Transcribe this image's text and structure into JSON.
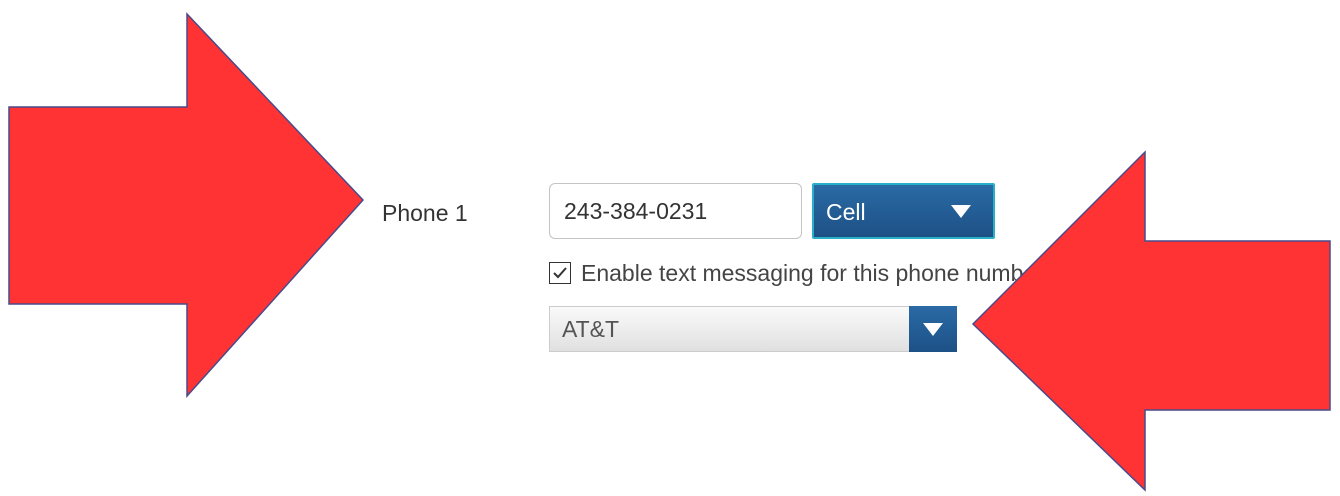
{
  "phone": {
    "label": "Phone 1",
    "number_value": "243-384-0231",
    "type_selected": "Cell"
  },
  "sms": {
    "checked": true,
    "label": "Enable text messaging for this phone number."
  },
  "carrier": {
    "selected": "AT&T"
  },
  "colors": {
    "arrow_fill": "#ff3333",
    "arrow_stroke": "#4a4a8a",
    "select_blue": "#1d5186",
    "select_border_accent": "#27b0c6"
  },
  "icons": {
    "arrow_pointing_right": "red-arrow-right-icon",
    "arrow_pointing_left": "red-arrow-left-icon",
    "dropdown_caret": "chevron-down-icon",
    "checkmark": "checkmark-icon"
  }
}
